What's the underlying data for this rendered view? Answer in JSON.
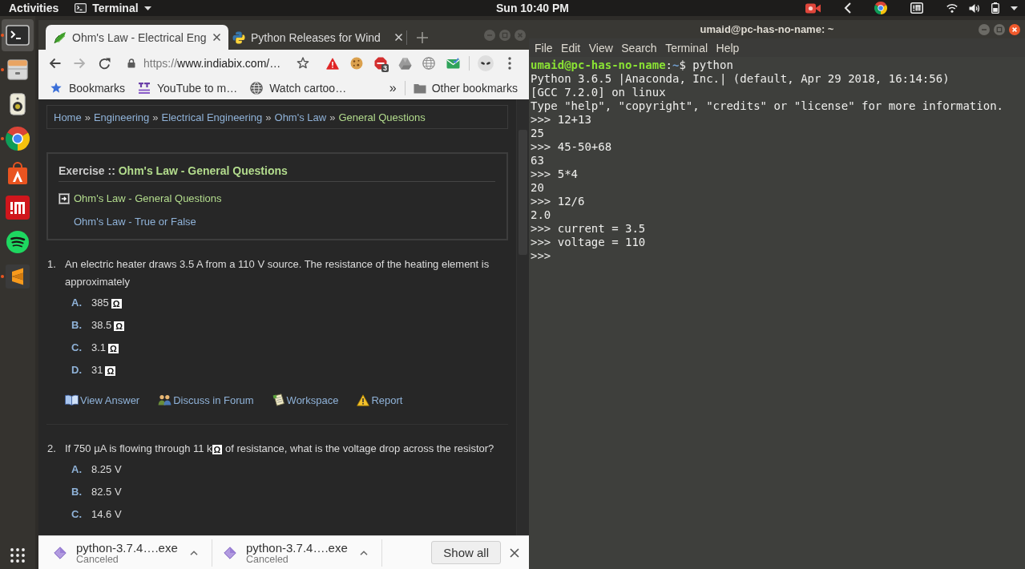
{
  "top_bar": {
    "activities": "Activities",
    "app_menu": "Terminal",
    "clock": "Sun 10:40 PM"
  },
  "dock": {
    "items": [
      {
        "kind": "terminal",
        "running": true,
        "selected": true
      },
      {
        "kind": "files",
        "running": true,
        "selected": false
      },
      {
        "kind": "speaker",
        "running": false,
        "selected": false
      },
      {
        "kind": "chrome",
        "running": true,
        "selected": false
      },
      {
        "kind": "store",
        "running": false,
        "selected": false
      },
      {
        "kind": "tile",
        "running": false,
        "selected": false
      },
      {
        "kind": "music",
        "running": false,
        "selected": false
      },
      {
        "kind": "editor",
        "running": true,
        "selected": false
      }
    ]
  },
  "browser": {
    "active": false,
    "tabs": [
      {
        "title": "Ohm's Law - Electrical Eng",
        "selected": true
      },
      {
        "title": "Python Releases for Wind",
        "selected": false
      }
    ],
    "back": {
      "disabled": false
    },
    "forward": {
      "disabled": true
    },
    "address": {
      "scheme": "https://",
      "rest": "www.indiabix.com/…"
    },
    "extensions": [
      {
        "kind": "warning"
      },
      {
        "kind": "cookie"
      },
      {
        "kind": "adblock",
        "badge": "3"
      },
      {
        "kind": "drive"
      },
      {
        "kind": "globe"
      },
      {
        "kind": "mail"
      }
    ],
    "bookmarks": [
      {
        "kind": "star",
        "label": "Bookmarks"
      },
      {
        "kind": "favicon",
        "label": "YouTube to m…"
      },
      {
        "kind": "globe",
        "label": "Watch cartoo…"
      }
    ],
    "bookmarks_overflow": "»",
    "other_bookmarks": "Other bookmarks",
    "page": {
      "breadcrumb": {
        "separator": "»",
        "items": [
          {
            "label": "Home",
            "current": false
          },
          {
            "label": "Engineering",
            "current": false
          },
          {
            "label": "Electrical Engineering",
            "current": false
          },
          {
            "label": "Ohm's Law",
            "current": false
          },
          {
            "label": "General Questions",
            "current": true
          }
        ]
      },
      "exercise": {
        "label": "Exercise ::",
        "topic": "Ohm's Law - General Questions",
        "links": [
          {
            "label": "Ohm's Law - General Questions",
            "selected": true
          },
          {
            "label": "Ohm's Law - True or False",
            "selected": false
          }
        ]
      },
      "questions": [
        {
          "number": "1.",
          "text": [
            {
              "kind": "text",
              "value": "An electric heater draws 3.5 A from a 110 V source. The resistance of the heating element is approximately"
            }
          ],
          "options": [
            {
              "letter": "A.",
              "value": "385",
              "unit": "Ω"
            },
            {
              "letter": "B.",
              "value": "38.5",
              "unit": "Ω"
            },
            {
              "letter": "C.",
              "value": "3.1",
              "unit": "Ω"
            },
            {
              "letter": "D.",
              "value": "31",
              "unit": "Ω"
            }
          ],
          "actions": [
            {
              "kind": "book",
              "label": "View Answer"
            },
            {
              "kind": "people",
              "label": "Discuss in Forum"
            },
            {
              "kind": "notepad",
              "label": "Workspace"
            },
            {
              "kind": "warning",
              "label": "Report"
            }
          ]
        },
        {
          "number": "2.",
          "text": [
            {
              "kind": "text",
              "value": "If 750 µA is flowing through 11 k"
            },
            {
              "kind": "unit",
              "value": "Ω"
            },
            {
              "kind": "text",
              "value": " of resistance, what is the voltage drop across the resistor?"
            }
          ],
          "options": [
            {
              "letter": "A.",
              "value": "8.25 V"
            },
            {
              "letter": "B.",
              "value": "82.5 V"
            },
            {
              "letter": "C.",
              "value": "14.6 V"
            }
          ]
        }
      ]
    },
    "downloads": {
      "items": [
        {
          "file": "python-3.7.4….exe",
          "status": "Canceled"
        },
        {
          "file": "python-3.7.4….exe",
          "status": "Canceled"
        }
      ],
      "show_all": "Show all"
    }
  },
  "terminal": {
    "active": true,
    "title": "umaid@pc-has-no-name: ~",
    "menu": [
      "File",
      "Edit",
      "View",
      "Search",
      "Terminal",
      "Help"
    ],
    "prompt": [
      {
        "kind": "user",
        "text": "umaid@pc-has-no-name"
      },
      {
        "kind": "separator",
        "text": ":"
      },
      {
        "kind": "path",
        "text": "~"
      },
      {
        "kind": "command",
        "text": "$ python"
      }
    ],
    "lines": [
      "Python 3.6.5 |Anaconda, Inc.| (default, Apr 29 2018, 16:14:56)",
      "[GCC 7.2.0] on linux",
      "Type \"help\", \"copyright\", \"credits\" or \"license\" for more information.",
      ">>> 12+13",
      "25",
      ">>> 45-50+68",
      "63",
      ">>> 5*4",
      "20",
      ">>> 12/6",
      "2.0",
      ">>> current = 3.5",
      ">>> voltage = 110",
      ">>>"
    ]
  }
}
